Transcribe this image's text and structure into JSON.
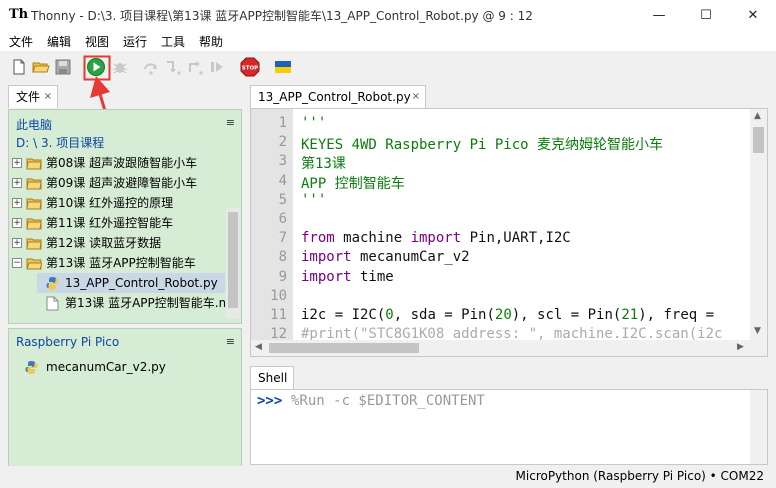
{
  "window": {
    "app_logo": "Th",
    "title": "Thonny  -  D:\\3. 项目课程\\第13课 蓝牙APP控制智能车\\13_APP_Control_Robot.py  @  9 : 12",
    "minimize": "—",
    "maximize": "☐",
    "close": "✕"
  },
  "menu": [
    "文件",
    "编辑",
    "视图",
    "运行",
    "工具",
    "帮助"
  ],
  "toolbar": {
    "icons": [
      "new-file-icon",
      "open-folder-icon",
      "save-icon",
      "run-icon",
      "debug-icon",
      "step-over-icon",
      "step-into-icon",
      "step-out-icon",
      "resume-icon",
      "stop-icon",
      "ukraine-flag-icon"
    ],
    "stop_label": "STOP"
  },
  "files_panel": {
    "tab_label": "文件",
    "tab_close": "×",
    "location_root": "此电脑",
    "location_path": "D: \\ 3. 项目课程",
    "menu_glyph": "≡",
    "items": [
      {
        "label": "第08课 超声波跟随智能小车",
        "type": "folder",
        "expander": "+"
      },
      {
        "label": "第09课 超声波避障智能小车",
        "type": "folder",
        "expander": "+"
      },
      {
        "label": "第10课 红外遥控的原理",
        "type": "folder",
        "expander": "+"
      },
      {
        "label": "第11课 红外遥控智能车",
        "type": "folder",
        "expander": "+"
      },
      {
        "label": "第12课 读取蓝牙数据",
        "type": "folder",
        "expander": "+"
      },
      {
        "label": "第13课 蓝牙APP控制智能车",
        "type": "folder",
        "expander": "−"
      },
      {
        "label": "13_APP_Control_Robot.py",
        "type": "python",
        "selected": true
      },
      {
        "label": "第13课 蓝牙APP控制智能车.m",
        "type": "doc"
      }
    ]
  },
  "device_panel": {
    "title": "Raspberry Pi Pico",
    "menu_glyph": "≡",
    "items": [
      {
        "label": "mecanumCar_v2.py",
        "type": "python"
      }
    ]
  },
  "editor": {
    "tab_label": "13_APP_Control_Robot.py",
    "tab_close": "×",
    "line_numbers": [
      "1",
      "2",
      "3",
      "4",
      "5",
      "6",
      "7",
      "8",
      "9",
      "10",
      "11",
      "12"
    ],
    "lines": [
      {
        "parts": [
          {
            "t": "'''",
            "c": "str"
          }
        ]
      },
      {
        "parts": [
          {
            "t": "KEYES 4WD Raspberry Pi Pico 麦克纳姆轮智能小车",
            "c": "str"
          }
        ]
      },
      {
        "parts": [
          {
            "t": "第13课",
            "c": "str"
          }
        ]
      },
      {
        "parts": [
          {
            "t": "APP 控制智能车",
            "c": "str"
          }
        ]
      },
      {
        "parts": [
          {
            "t": "'''",
            "c": "str"
          }
        ]
      },
      {
        "parts": []
      },
      {
        "parts": [
          {
            "t": "from",
            "c": "kw"
          },
          {
            "t": " machine ",
            "c": ""
          },
          {
            "t": "import",
            "c": "kw"
          },
          {
            "t": " Pin,UART,I2C",
            "c": ""
          }
        ]
      },
      {
        "parts": [
          {
            "t": "import",
            "c": "kw"
          },
          {
            "t": " mecanumCar_v2",
            "c": ""
          }
        ]
      },
      {
        "parts": [
          {
            "t": "import",
            "c": "kw"
          },
          {
            "t": " time",
            "c": ""
          }
        ]
      },
      {
        "parts": []
      },
      {
        "parts": [
          {
            "t": "i2c = I2C(",
            "c": ""
          },
          {
            "t": "0",
            "c": "num"
          },
          {
            "t": ", sda = Pin(",
            "c": ""
          },
          {
            "t": "20",
            "c": "num"
          },
          {
            "t": "), scl = Pin(",
            "c": ""
          },
          {
            "t": "21",
            "c": "num"
          },
          {
            "t": "), freq = ",
            "c": ""
          }
        ]
      },
      {
        "parts": [
          {
            "t": "#print(\"STC8G1K08 address: \", machine.I2C.scan(i2c",
            "c": "comment"
          }
        ]
      }
    ]
  },
  "shell": {
    "tab_label": "Shell",
    "prompt": ">>>",
    "command": "%Run -c $EDITOR_CONTENT"
  },
  "status": {
    "text": "MicroPython (Raspberry Pi Pico)  •  COM22"
  },
  "colors": {
    "files_bg": "#d6ecd4",
    "run_green": "#27a443",
    "annotation_red": "#e53935",
    "link_blue": "#0b47a1"
  }
}
